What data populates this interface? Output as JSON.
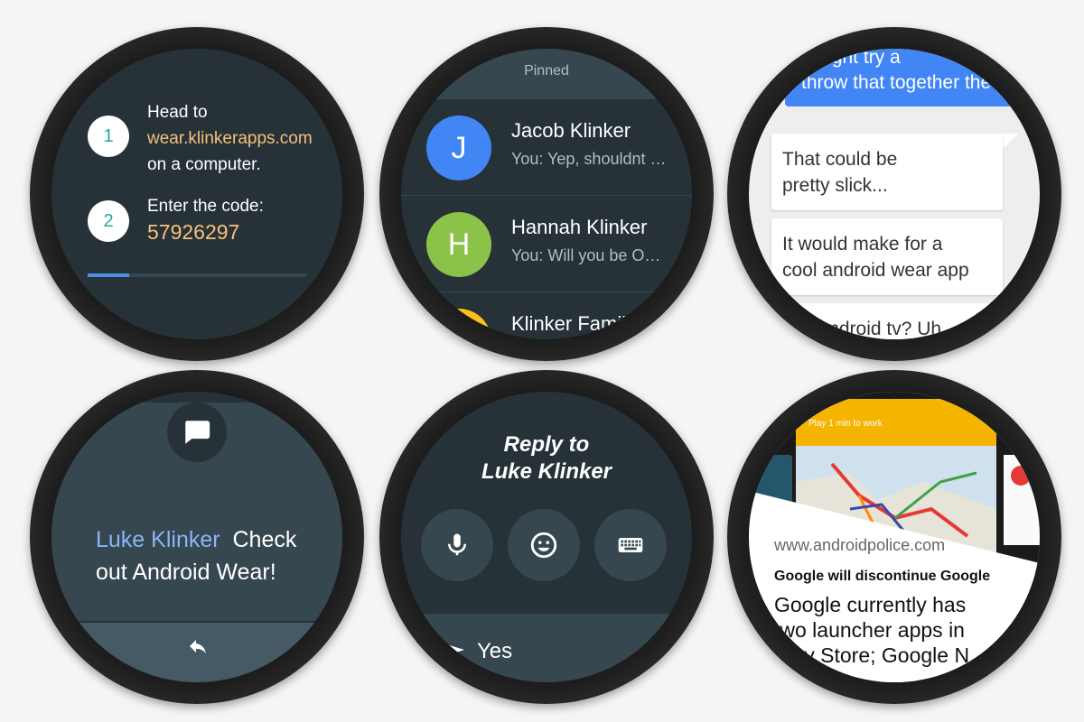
{
  "setup": {
    "step1_number": "1",
    "step1_line1": "Head to",
    "step1_link": "wear.klinkerapps.com",
    "step1_line3": "on a computer.",
    "step2_number": "2",
    "step2_label": "Enter the code:",
    "step2_code": "57926297",
    "progress_fraction": 0.19
  },
  "conversations": {
    "header": "Pinned",
    "items": [
      {
        "initial": "J",
        "name": "Jacob Klinker",
        "snippet": "You: Yep, shouldnt be too bad",
        "color": "#4285f4"
      },
      {
        "initial": "H",
        "name": "Hannah Klinker",
        "snippet": "You: Will you be OK with that",
        "color": "#8bc34a"
      },
      {
        "initial": "",
        "name": "Klinker Family",
        "snippet": "",
        "color": "#f9c11c"
      }
    ]
  },
  "thread": {
    "sent_line1": "I might try a",
    "sent_line2": "throw that together the",
    "received1_line1": "That could be",
    "received1_line2": "pretty slick...",
    "received2_line1": "It would make for a",
    "received2_line2": "cool android wear app",
    "received3_partial": "d android tv? Uh"
  },
  "notification": {
    "sender": "Luke Klinker",
    "message_line1": "Check",
    "message_line2": "out Android Wear!",
    "message_icon": "message-icon",
    "reply_icon": "reply-icon"
  },
  "reply": {
    "title_line1": "Reply to",
    "title_line2": "Luke Klinker",
    "actions": [
      "microphone-icon",
      "emoji-icon",
      "keyboard-icon"
    ],
    "suggestion": "Yes"
  },
  "article": {
    "map_banner": "Play 1 min to work",
    "url": "www.androidpolice.com",
    "headline": "Google will discontinue Google",
    "body_line1": "Google currently has",
    "body_line2": "two launcher apps in",
    "body_line3": "Play Store; Google N"
  }
}
